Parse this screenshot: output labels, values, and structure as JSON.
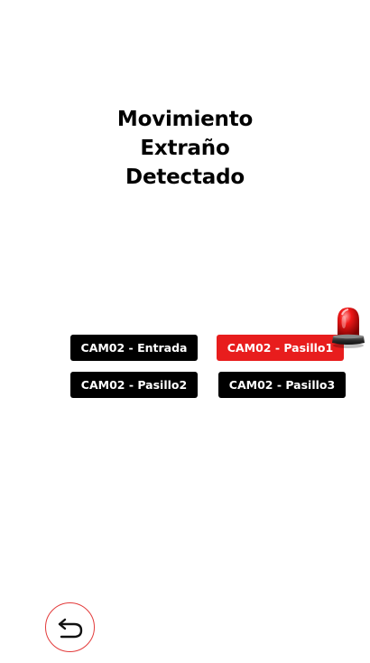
{
  "title": {
    "line1": "Movimiento",
    "line2": "Extraño",
    "line3": "Detectado"
  },
  "cameras": [
    {
      "label": "CAM02 - Entrada",
      "status": "normal"
    },
    {
      "label": "CAM02 - Pasillo1",
      "status": "alert"
    },
    {
      "label": "CAM02 - Pasillo2",
      "status": "normal"
    },
    {
      "label": "CAM02 - Pasillo3",
      "status": "normal"
    }
  ],
  "alert_icon": "siren-icon",
  "back_icon": "back-arrow-icon",
  "colors": {
    "background": "#ffffff",
    "button": "#000000",
    "alert": "#e81d1d",
    "back_border": "#e33b3b",
    "text_light": "#ffffff",
    "text_dark": "#000000"
  }
}
